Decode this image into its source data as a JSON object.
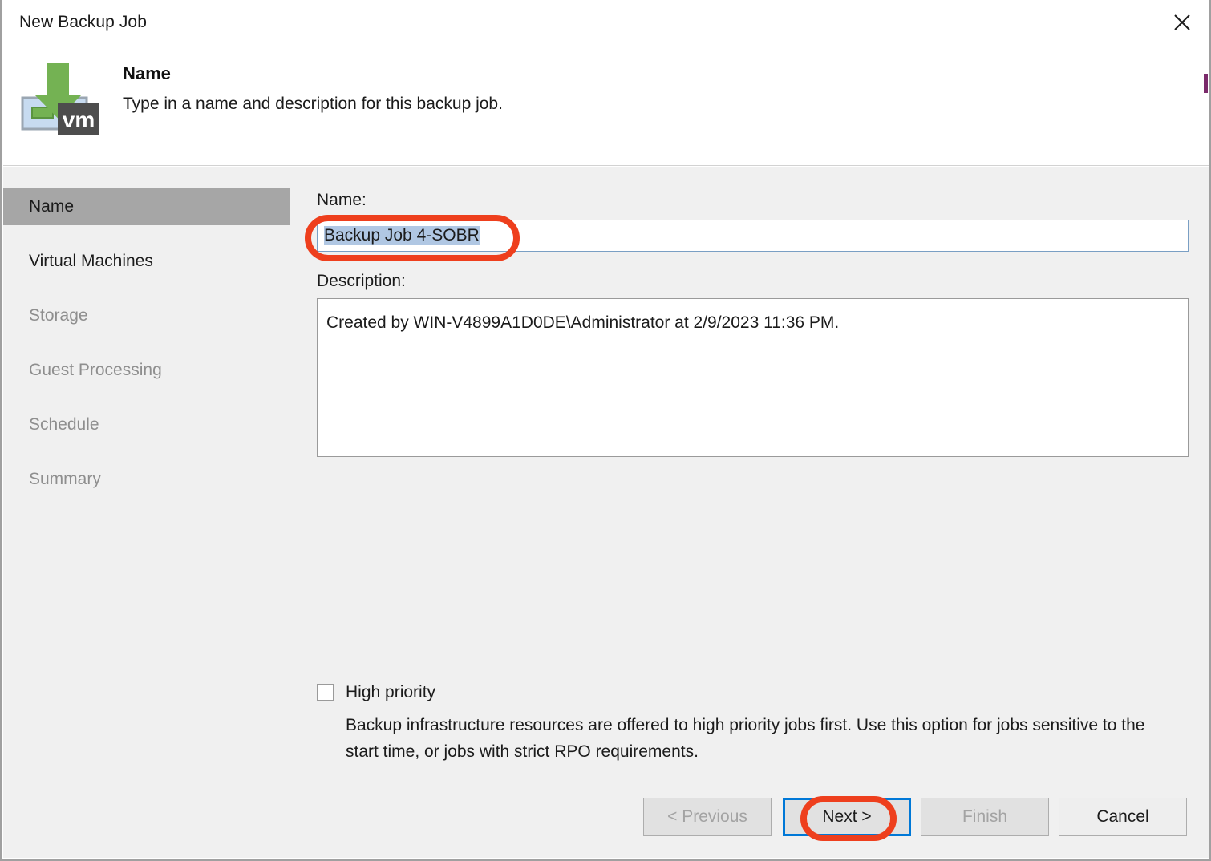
{
  "window": {
    "title": "New Backup Job",
    "close_icon": "close-icon"
  },
  "header": {
    "icon": "backup-job-vm-icon",
    "title": "Name",
    "subtitle": "Type in a name and description for this backup job."
  },
  "sidebar": {
    "items": [
      {
        "label": "Name",
        "state": "active"
      },
      {
        "label": "Virtual Machines",
        "state": "normal"
      },
      {
        "label": "Storage",
        "state": "dim"
      },
      {
        "label": "Guest Processing",
        "state": "dim"
      },
      {
        "label": "Schedule",
        "state": "dim"
      },
      {
        "label": "Summary",
        "state": "dim"
      }
    ]
  },
  "main": {
    "name_label": "Name:",
    "name_value": "Backup Job 4-SOBR",
    "name_selected": true,
    "description_label": "Description:",
    "description_value": "Created by WIN-V4899A1D0DE\\Administrator at 2/9/2023 11:36 PM.",
    "high_priority": {
      "label": "High priority",
      "checked": false,
      "help_text": "Backup infrastructure resources are offered to high priority jobs first. Use this option for jobs sensitive to the start time, or jobs with strict RPO requirements."
    }
  },
  "footer": {
    "buttons": [
      {
        "label": "< Previous",
        "state": "disabled"
      },
      {
        "label": "Next >",
        "state": "focused"
      },
      {
        "label": "Finish",
        "state": "disabled"
      },
      {
        "label": "Cancel",
        "state": "enabled"
      }
    ]
  },
  "annotations": {
    "color": "#ee3f1d",
    "targets": [
      "name-input",
      "next-button"
    ]
  },
  "colors": {
    "dialog_background": "#ffffff",
    "panel_background": "#f0f0f0",
    "sidebar_active": "#a6a6a6",
    "text_primary": "#1b1b1b",
    "text_dim": "#8e8e8e",
    "selection_highlight": "#b0c7e3",
    "focus_border": "#0078d7",
    "annotation_red": "#ee3f1d",
    "icon_green": "#74b253",
    "icon_blue": "#bcd2ea",
    "icon_dark": "#4d4d4d"
  }
}
